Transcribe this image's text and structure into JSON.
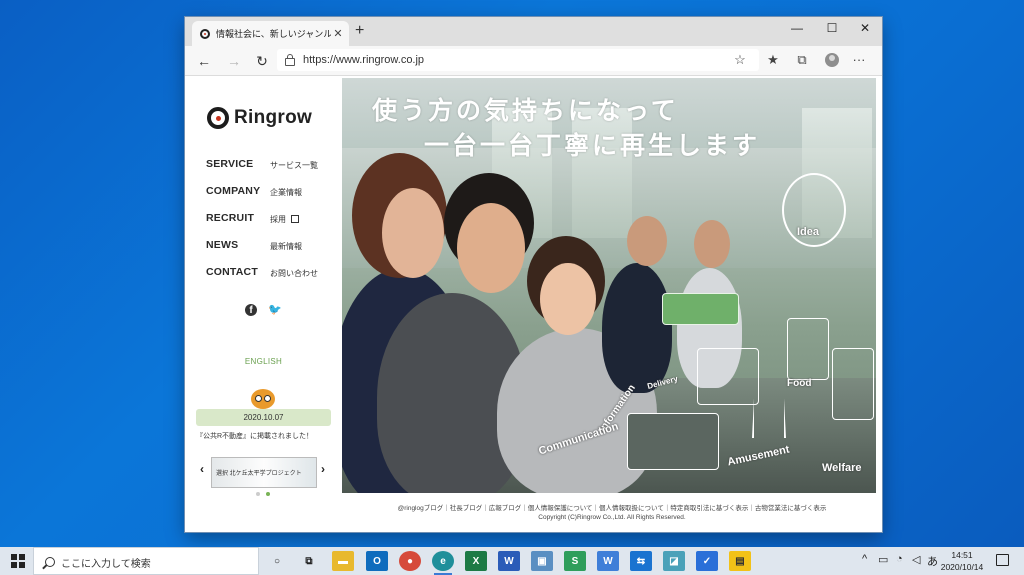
{
  "browser": {
    "tab_title": "情報社会に、新しいジャンルを創る。",
    "tab_close": "✕",
    "new_tab": "+",
    "url": "https://www.ringrow.co.jp",
    "controls": {
      "minimize": "—",
      "maximize": "☐",
      "close": "✕"
    },
    "icons": {
      "back": "←",
      "forward": "→",
      "refresh": "↻",
      "favorite": "☆",
      "favorites_list": "★",
      "collections": "⧉",
      "more": "···"
    }
  },
  "site": {
    "logo_text": "Ringrow",
    "nav": [
      {
        "en": "SERVICE",
        "jp": "サービス一覧"
      },
      {
        "en": "COMPANY",
        "jp": "企業情報"
      },
      {
        "en": "RECRUIT",
        "jp": "採用"
      },
      {
        "en": "NEWS",
        "jp": "最新情報"
      },
      {
        "en": "CONTACT",
        "jp": "お問い合わせ"
      }
    ],
    "social": {
      "facebook": "f",
      "twitter": "🐦"
    },
    "english": "ENGLISH",
    "news": {
      "date": "2020.10.07",
      "text": "『公共R不動産』に掲載されました！"
    },
    "carousel": {
      "prev": "‹",
      "next": "›",
      "banner_text": "選択 北ケ丘太平学プロジェクト"
    },
    "hero": {
      "line1": "使う方の気持ちになって",
      "line2": "一台一台丁寧に再生します",
      "doodles": {
        "idea": "Idea",
        "information": "Information",
        "communication": "Communication",
        "amusement": "Amusement",
        "welfare": "Welfare",
        "food": "Food",
        "delivery": "Delivery"
      }
    },
    "footer": {
      "links": "@ringlogブログ｜社長ブログ｜広報ブログ｜個人情報保護について｜個人情報取扱について｜特定商取引法に基づく表示｜古物営業法に基づく表示",
      "copyright": "Copyright (C)Ringrow Co.,Ltd. All Rights Reserved."
    }
  },
  "taskbar": {
    "search_placeholder": "ここに入力して検索",
    "apps": [
      {
        "name": "cortana",
        "glyph": "○",
        "color": "#dfe6ee"
      },
      {
        "name": "task-view",
        "glyph": "⧉",
        "color": "#dfe6ee"
      },
      {
        "name": "file-explorer",
        "glyph": "▬",
        "color": "#e8b92e"
      },
      {
        "name": "outlook",
        "glyph": "O",
        "color": "#0f6cbd"
      },
      {
        "name": "chrome",
        "glyph": "●",
        "color": "#d64a3a"
      },
      {
        "name": "edge",
        "glyph": "e",
        "color": "#1f8f9a"
      },
      {
        "name": "excel",
        "glyph": "X",
        "color": "#1d7a45"
      },
      {
        "name": "word",
        "glyph": "W",
        "color": "#2b5cb8"
      },
      {
        "name": "remote-desktop",
        "glyph": "▣",
        "color": "#5a8fc2"
      },
      {
        "name": "green-app",
        "glyph": "S",
        "color": "#2f9e5b"
      },
      {
        "name": "writer",
        "glyph": "W",
        "color": "#3f7fd8"
      },
      {
        "name": "teamviewer",
        "glyph": "⇆",
        "color": "#1a73d0"
      },
      {
        "name": "app-teal",
        "glyph": "◪",
        "color": "#4aa1b9"
      },
      {
        "name": "todo",
        "glyph": "✓",
        "color": "#2a6fd8"
      },
      {
        "name": "sticky-notes",
        "glyph": "▤",
        "color": "#f2c218"
      }
    ],
    "tray": {
      "chevron": "^",
      "ime": "あ"
    },
    "time": "14:51",
    "date": "2020/10/14"
  }
}
